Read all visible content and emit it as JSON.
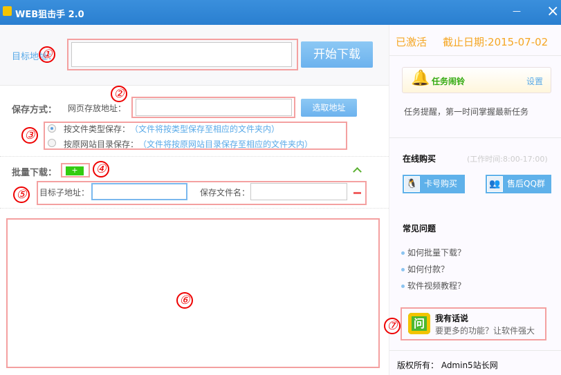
{
  "window": {
    "title": "WEB狙击手 2.0",
    "close": "×",
    "minimize": "—"
  },
  "target": {
    "label": "目标地址：",
    "value": "",
    "start_button": "开始下载"
  },
  "save": {
    "label": "保存方式：",
    "path_label": "网页存放地址：",
    "path_value": "",
    "choose_button": "选取地址",
    "options": [
      {
        "label": "按文件类型保存：",
        "hint": "（文件将按类型保存至相应的文件夹内）",
        "selected": true
      },
      {
        "label": "按原网站目录保存：",
        "hint": "（文件将按原网站目录保存至相应的文件夹内）",
        "selected": false
      }
    ]
  },
  "batch": {
    "label": "批量下载：",
    "add": "+",
    "sub_url_label": "目标子地址：",
    "sub_url_value": "",
    "file_name_label": "保存文件名：",
    "file_name_value": "",
    "collapse_icon": "chevron-up-icon"
  },
  "markers": [
    "①",
    "②",
    "③",
    "④",
    "⑤",
    "⑥",
    "⑦"
  ],
  "sidebar": {
    "status": "已激活",
    "expiry": "截止日期:2015-07-02",
    "alarm": {
      "title": "任务闹铃",
      "settings": "设置",
      "desc": "任务提醒，第一时间掌握最新任务"
    },
    "buy": {
      "title": "在线购买",
      "hours": "(工作时间:8:00-17:00)",
      "card_button": "卡号购买",
      "qq_button": "售后QQ群"
    },
    "faq": {
      "title": "常见问题",
      "items": [
        "如何批量下载？",
        "如何付款？",
        "软件视频教程？"
      ]
    },
    "feedback": {
      "title": "我有话说",
      "desc": "要更多的功能？让软件强大",
      "icon_text": "问"
    },
    "copyright": "版权所有： Admin5站长网"
  },
  "colors": {
    "titlebar": "#2a7fd0",
    "accent": "#6cb2ee",
    "orange": "#f5a623",
    "green": "#33cc11",
    "marker": "#e00000"
  }
}
